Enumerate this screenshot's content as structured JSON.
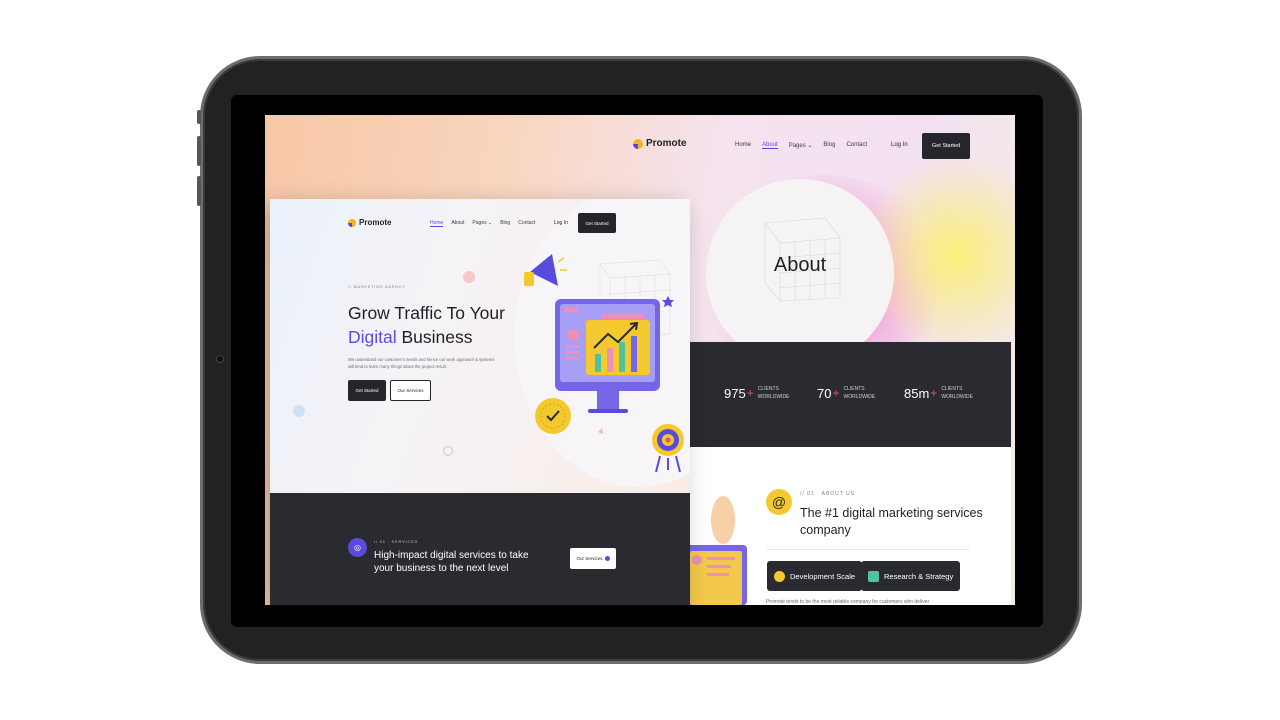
{
  "back_page": {
    "logo": "Promote",
    "nav": [
      "Home",
      "About",
      "Pages",
      "Blog",
      "Contact"
    ],
    "nav_active": "About",
    "login": "Log In",
    "cta": "Get Started",
    "hero_title": "About",
    "stats": [
      {
        "value": "975",
        "suffix": "+",
        "label1": "CLIENTS",
        "label2": "WORLDWIDE"
      },
      {
        "value": "70",
        "suffix": "+",
        "label1": "CLIENTS",
        "label2": "WORLDWIDE"
      },
      {
        "value": "85m",
        "suffix": "+",
        "label1": "CLIENTS",
        "label2": "WORLDWIDE"
      }
    ],
    "about_kicker": "// 01 . ABOUT US",
    "about_heading": "The #1 digital marketing services company",
    "chips": [
      "Development Scale",
      "Research & Strategy"
    ],
    "body_text": "Promote tends to be the most reliable company for customers who deliver"
  },
  "front_page": {
    "logo": "Promote",
    "nav": [
      "Home",
      "About",
      "Pages",
      "Blog",
      "Contact"
    ],
    "nav_active": "Home",
    "login": "Log In",
    "cta": "Get Started",
    "kicker": "MARKETING AGENCY",
    "title_line1": "Grow Traffic To Your",
    "title_highlight": "Digital",
    "title_rest": " Business",
    "description": "We understand our customer's needs and hence our work approach & systems will tend to learn many things about the project result.",
    "btn_primary": "Get Started",
    "btn_secondary": "Our Services",
    "services_kicker": "// 01 . SERVICES",
    "services_title": "High-impact digital services to take your business to the next level",
    "services_btn": "Our Services"
  },
  "colors": {
    "accent": "#5a4bdc",
    "dark": "#2a2b31",
    "yellow": "#f3c92e",
    "plus": "#e94b6c"
  }
}
